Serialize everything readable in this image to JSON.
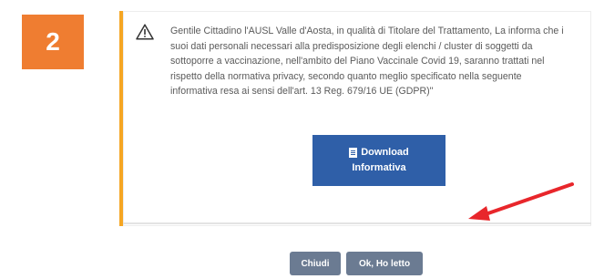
{
  "step_badge": {
    "number": "2",
    "color": "#ef7d31"
  },
  "notice": {
    "icon": "warning-triangle-icon",
    "accent_color": "#f5a623",
    "lines": [
      "Gentile Cittadino l'AUSL Valle d'Aosta, in qualità di Titolare del Trattamento, La informa che i",
      "suoi dati personali necessari alla predisposizione degli elenchi / cluster di soggetti da",
      "sottoporre a vaccinazione, nell'ambito del Piano Vaccinale Covid 19, saranno trattati nel",
      "rispetto della normativa privacy, secondo quanto meglio specificato nella seguente",
      "informativa resa ai sensi dell'art. 13 Reg. 679/16 UE (GDPR)\""
    ]
  },
  "download_button": {
    "icon": "pdf-file-icon",
    "line1": "Download",
    "line2": "Informativa",
    "color": "#2f5fa8"
  },
  "annotation": {
    "icon": "red-arrow-icon",
    "color": "#e8262b"
  },
  "footer": {
    "close_label": "Chiudi",
    "ok_label": "Ok, Ho letto",
    "button_color": "#6b7b92"
  }
}
